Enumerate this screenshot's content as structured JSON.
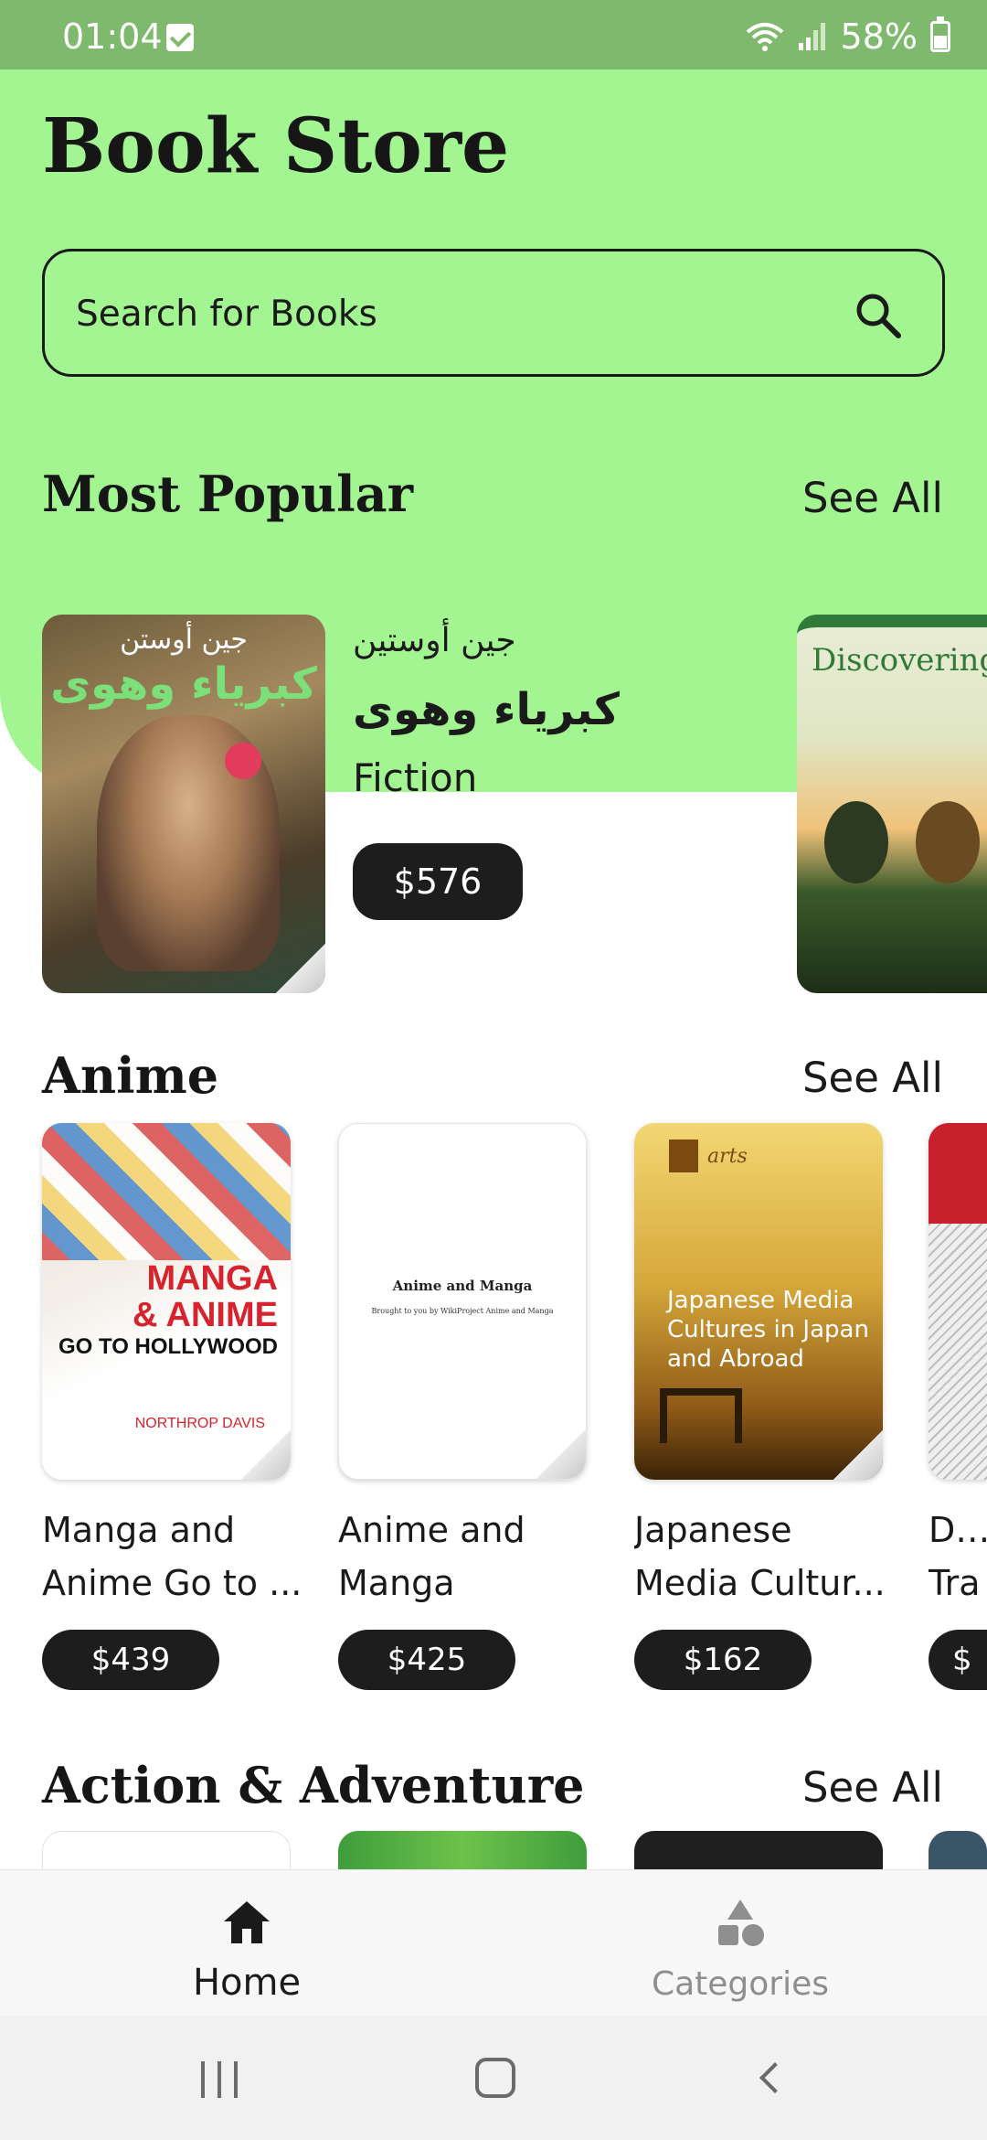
{
  "status_bar": {
    "time": "01:04",
    "battery": "58%"
  },
  "page_title": "Book Store",
  "search": {
    "placeholder": "Search for Books"
  },
  "sections": {
    "popular": {
      "title": "Most Popular",
      "see_all": "See All"
    },
    "anime": {
      "title": "Anime",
      "see_all": "See All"
    },
    "action": {
      "title": "Action & Adventure",
      "see_all": "See All"
    }
  },
  "popular_book": {
    "author": "جين أوستين",
    "title": "كبرياء وهوى",
    "genre": "Fiction",
    "price": "$576",
    "cover_text_top": "جين أوستن",
    "cover_text_title": "كبرياء وهوى"
  },
  "popular_book_2": {
    "cover_title": "Discovering F"
  },
  "anime_books": [
    {
      "title_line1": "Manga and",
      "title_line2": "Anime Go to ...",
      "price": "$439",
      "cover_lines": [
        "MANGA",
        "& ANIME"
      ],
      "cover_sub": "GO TO HOLLYWOOD",
      "cover_author": "NORTHROP DAVIS"
    },
    {
      "title_line1": "Anime and",
      "title_line2": "Manga",
      "price": "$425",
      "cover_title": "Anime and Manga",
      "cover_sub": "Brought to you by WikiProject Anime and Manga"
    },
    {
      "title_line1": "Japanese",
      "title_line2": "Media Cultur...",
      "price": "$162",
      "cover_brand": "arts",
      "cover_title": "Japanese Media Cultures in Japan and Abroad"
    },
    {
      "title_line1": "Dra",
      "title_line2": "Tra",
      "price": "$"
    }
  ],
  "bottom_nav": {
    "home": "Home",
    "categories": "Categories"
  },
  "colors": {
    "header_green": "#a2f590",
    "status_green": "#7fb96d",
    "pill": "#1d1d1d"
  }
}
